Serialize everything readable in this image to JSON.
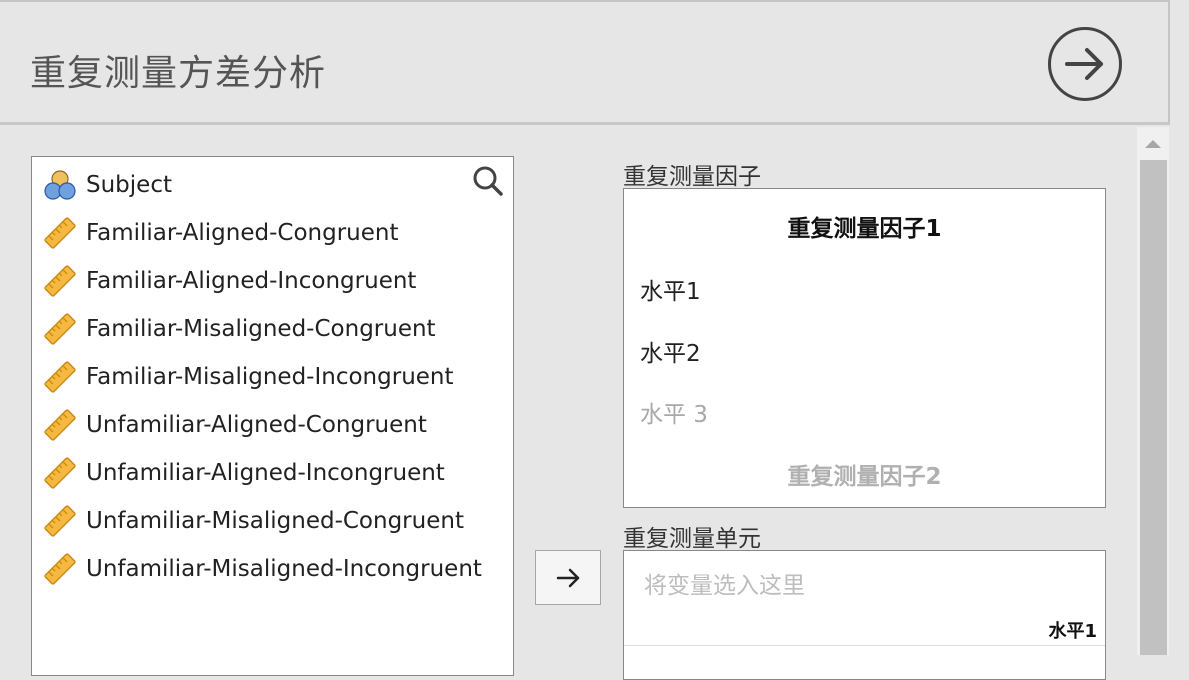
{
  "header": {
    "title": "重复测量方差分析"
  },
  "variables": {
    "items": [
      {
        "label": "Subject",
        "icon": "nominal-variable-icon"
      },
      {
        "label": "Familiar-Aligned-Congruent",
        "icon": "continuous-variable-icon"
      },
      {
        "label": "Familiar-Aligned-Incongruent",
        "icon": "continuous-variable-icon"
      },
      {
        "label": "Familiar-Misaligned-Congruent",
        "icon": "continuous-variable-icon"
      },
      {
        "label": "Familiar-Misaligned-Incongruent",
        "icon": "continuous-variable-icon"
      },
      {
        "label": "Unfamiliar-Aligned-Congruent",
        "icon": "continuous-variable-icon"
      },
      {
        "label": "Unfamiliar-Aligned-Incongruent",
        "icon": "continuous-variable-icon"
      },
      {
        "label": "Unfamiliar-Misaligned-Congruent",
        "icon": "continuous-variable-icon"
      },
      {
        "label": "Unfamiliar-Misaligned-Incongruent",
        "icon": "continuous-variable-icon"
      }
    ]
  },
  "factors": {
    "label": "重复测量因子",
    "factor1": "重复测量因子1",
    "levels": [
      "水平1",
      "水平2"
    ],
    "level_placeholder": "水平 3",
    "factor2_placeholder": "重复测量因子2"
  },
  "cells": {
    "label": "重复测量单元",
    "placeholder": "将变量选入这里",
    "column_header": "水平1"
  },
  "colors": {
    "ruler": "#f5b942",
    "nominal_top": "#f0c060",
    "nominal_bottom": "#6fa0e0"
  }
}
